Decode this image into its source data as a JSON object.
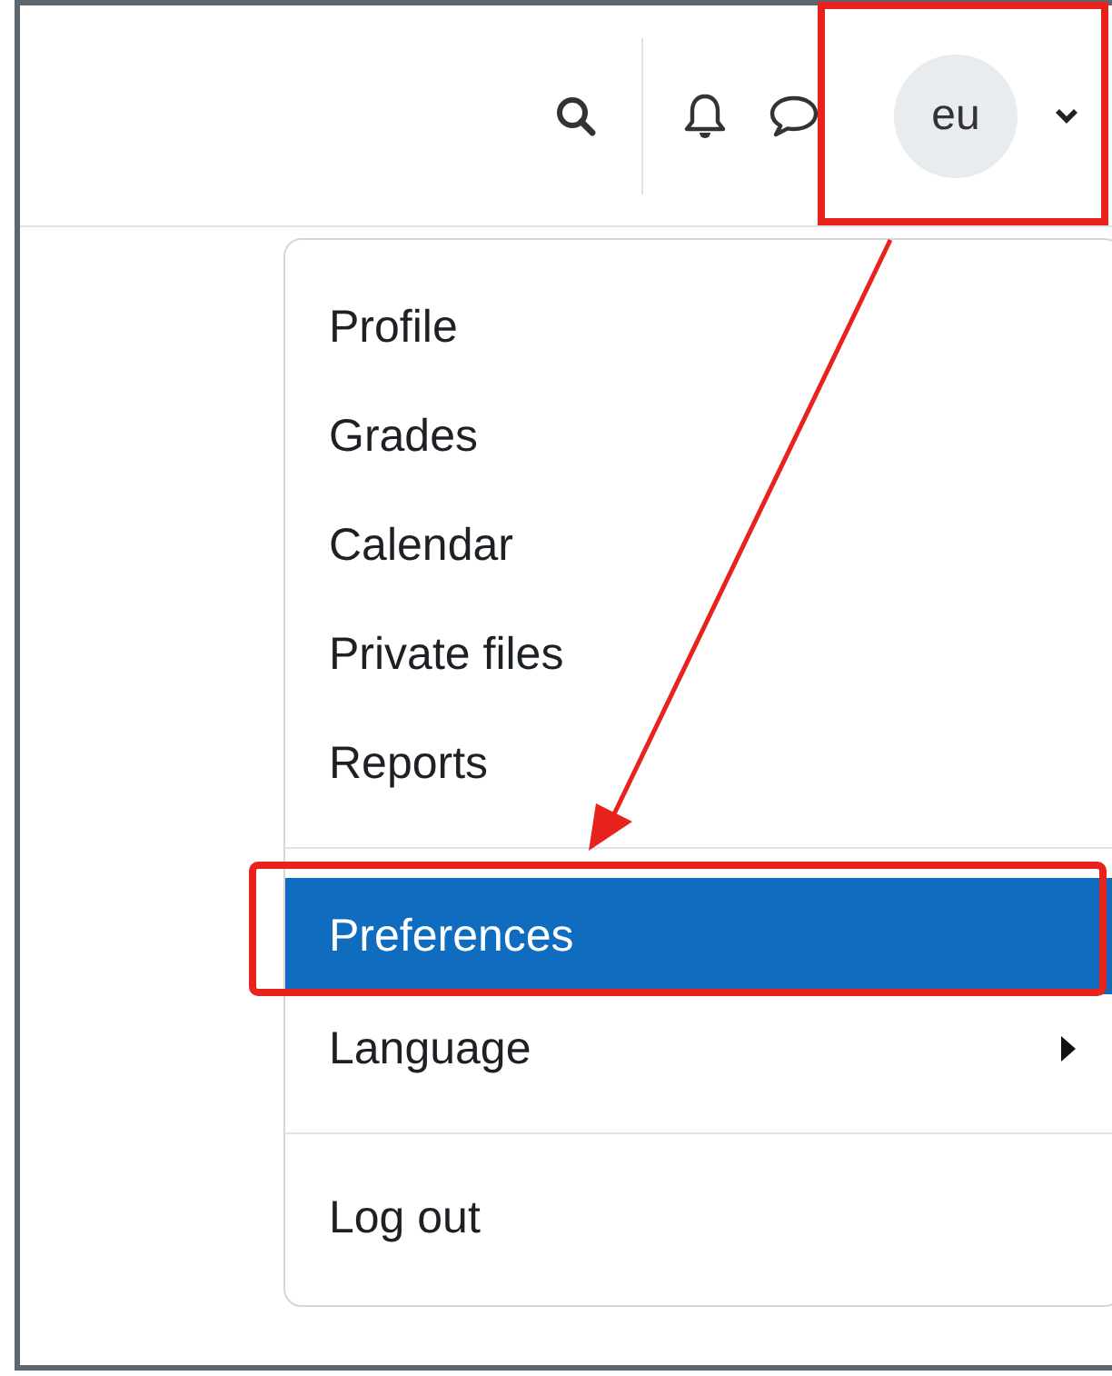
{
  "header": {
    "avatar": {
      "initials": "eu"
    }
  },
  "user_menu": {
    "groups": [
      [
        {
          "label": "Profile",
          "selected": false,
          "submenu": false
        },
        {
          "label": "Grades",
          "selected": false,
          "submenu": false
        },
        {
          "label": "Calendar",
          "selected": false,
          "submenu": false
        },
        {
          "label": "Private files",
          "selected": false,
          "submenu": false
        },
        {
          "label": "Reports",
          "selected": false,
          "submenu": false
        }
      ],
      [
        {
          "label": "Preferences",
          "selected": true,
          "submenu": false
        },
        {
          "label": "Language",
          "selected": false,
          "submenu": true
        }
      ],
      [
        {
          "label": "Log out",
          "selected": false,
          "submenu": false
        }
      ]
    ]
  }
}
